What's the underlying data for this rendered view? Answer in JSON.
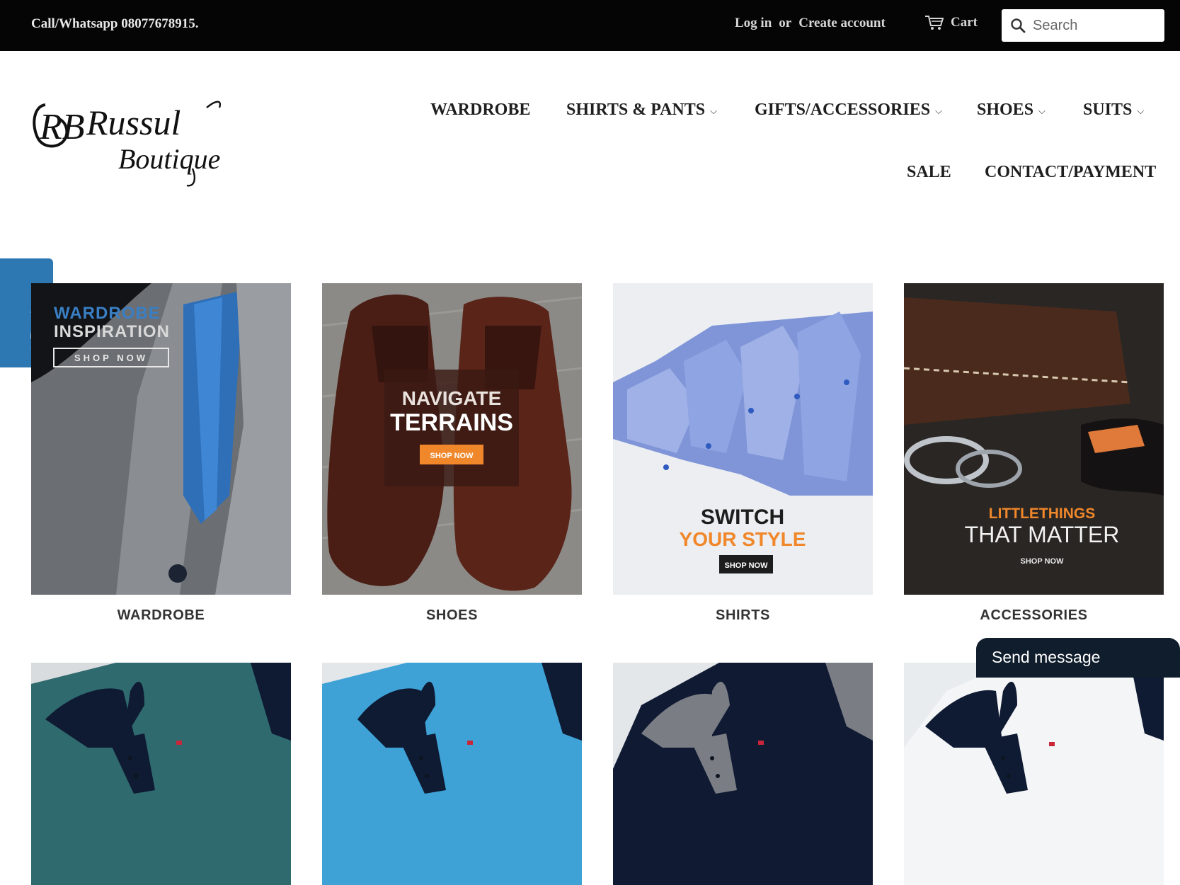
{
  "topbar": {
    "phone": "Call/Whatsapp 08077678915.",
    "login": "Log in",
    "or": "or",
    "create_account": "Create account",
    "cart": "Cart",
    "search_placeholder": "Search",
    "background": "#050505"
  },
  "brand": {
    "monogram": "RB",
    "line1": "Russul",
    "line2": "Boutique"
  },
  "nav": {
    "items": [
      {
        "label": "WARDROBE",
        "has_dropdown": false
      },
      {
        "label": "SHIRTS & PANTS",
        "has_dropdown": true
      },
      {
        "label": "GIFTS/ACCESSORIES",
        "has_dropdown": true
      },
      {
        "label": "SHOES",
        "has_dropdown": true
      },
      {
        "label": "SUITS",
        "has_dropdown": true
      },
      {
        "label": "SALE",
        "has_dropdown": false
      },
      {
        "label": "CONTACT/PAYMENT",
        "has_dropdown": false
      }
    ],
    "chevron": "⌵"
  },
  "reviews_tab": {
    "label": "Reviews",
    "icon": "star-icon",
    "color": "#2d77b2"
  },
  "collections": [
    {
      "label": "WARDROBE",
      "banner": {
        "line1": "WARDROBE",
        "line2": "INSPIRATION",
        "cta": "SHOP NOW"
      }
    },
    {
      "label": "SHOES",
      "banner": {
        "line1": "NAVIGATE",
        "line2": "TERRAINS",
        "cta": "SHOP NOW"
      }
    },
    {
      "label": "SHIRTS",
      "banner": {
        "line1": "SWITCH",
        "line2": "YOUR STYLE",
        "cta": "SHOP NOW"
      }
    },
    {
      "label": "ACCESSORIES",
      "banner": {
        "line1": "LITTLETHINGS",
        "line2": "THAT MATTER",
        "cta": "SHOP NOW"
      }
    }
  ],
  "products": [
    {
      "color": "#2f6a6e",
      "collar": "#0f1a33"
    },
    {
      "color": "#3ea2d6",
      "collar": "#0f1a33"
    },
    {
      "color": "#101a33",
      "collar": "#7a7d84"
    },
    {
      "color": "#eef1f3",
      "collar": "#0f1a33"
    }
  ],
  "chat_widget": {
    "label": "Send message",
    "color": "#0f1d2c"
  },
  "accent_colors": {
    "orange": "#f0872a",
    "blue_text": "#3a7fc4"
  }
}
